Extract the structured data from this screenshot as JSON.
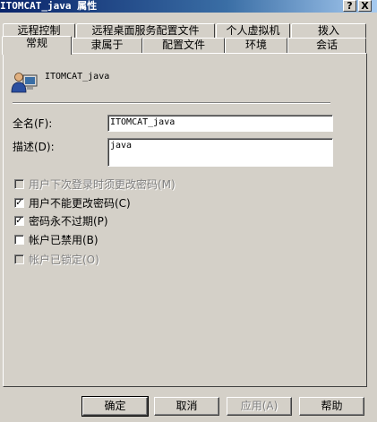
{
  "window": {
    "title": "ITOMCAT_java 属性",
    "help_glyph": "?",
    "close_glyph": "X"
  },
  "tabs": {
    "row1": [
      "远程控制",
      "远程桌面服务配置文件",
      "个人虚拟机",
      "拨入"
    ],
    "row2": [
      "常规",
      "隶属于",
      "配置文件",
      "环境",
      "会话"
    ],
    "active": "常规"
  },
  "general": {
    "user_icon": "user-icon",
    "username": "ITOMCAT_java",
    "full_name_label": "全名(F):",
    "full_name_value": "ITOMCAT_java",
    "description_label": "描述(D):",
    "description_value": "java"
  },
  "options": [
    {
      "label": "用户下次登录时须更改密码(M)",
      "checked": false,
      "disabled": true
    },
    {
      "label": "用户不能更改密码(C)",
      "checked": true,
      "disabled": false
    },
    {
      "label": "密码永不过期(P)",
      "checked": true,
      "disabled": false
    },
    {
      "label": "帐户已禁用(B)",
      "checked": false,
      "disabled": false
    },
    {
      "label": "帐户已锁定(O)",
      "checked": false,
      "disabled": true
    }
  ],
  "buttons": {
    "ok": "确定",
    "cancel": "取消",
    "apply": "应用(A)",
    "help": "帮助"
  }
}
